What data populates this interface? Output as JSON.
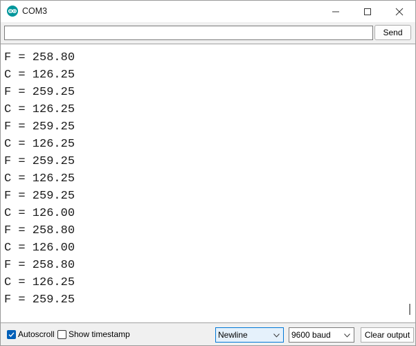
{
  "window": {
    "title": "COM3",
    "icon": "arduino-logo-icon",
    "controls": [
      "minimize-icon",
      "maximize-icon",
      "close-icon"
    ]
  },
  "input": {
    "value": "",
    "send_label": "Send"
  },
  "output": {
    "lines": [
      "F = 258.80",
      "C = 126.25",
      "F = 259.25",
      "C = 126.25",
      "F = 259.25",
      "C = 126.25",
      "F = 259.25",
      "C = 126.25",
      "F = 259.25",
      "C = 126.00",
      "F = 258.80",
      "C = 126.00",
      "F = 258.80",
      "C = 126.25",
      "F = 259.25"
    ]
  },
  "footer": {
    "autoscroll_label": "Autoscroll",
    "autoscroll_checked": true,
    "timestamp_label": "Show timestamp",
    "timestamp_checked": false,
    "line_ending": "Newline",
    "baud_rate": "9600 baud",
    "clear_label": "Clear output"
  },
  "colors": {
    "logo": "#00979c",
    "checkbox_accent": "#005fb8",
    "select_highlight": "#e5f1fb"
  }
}
